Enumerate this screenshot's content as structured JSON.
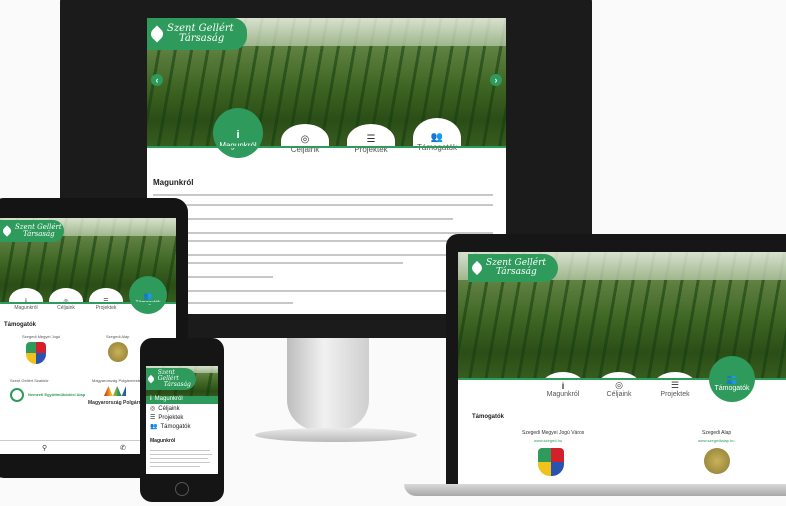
{
  "site": {
    "logo_line1": "Szent Gellért",
    "logo_line2": "Társaság"
  },
  "tabs": [
    {
      "label": "Magunkról",
      "icon": "info-icon"
    },
    {
      "label": "Céljaink",
      "icon": "target-icon"
    },
    {
      "label": "Projektek",
      "icon": "list-icon"
    },
    {
      "label": "Támogatók",
      "icon": "people-icon"
    }
  ],
  "desktop": {
    "active_tab": "Magunkról",
    "heading": "Magunkról"
  },
  "tablet": {
    "active_tab": "Támogatók",
    "heading": "Támogatók",
    "sponsor_label": "Magyarország Polgármesteri Iroda"
  },
  "phone": {
    "menu": [
      "Magunkról",
      "Céljaink",
      "Projektek",
      "Támogatók"
    ],
    "heading": "Magunkról"
  },
  "laptop": {
    "active_tab": "Támogatók",
    "heading": "Támogatók",
    "sponsor1": "Szegedi Megyei Jogú Város",
    "sponsor2": "Szegedi Alap"
  },
  "colors": {
    "brand_green": "#2e9a5b",
    "device_black": "#1b1b1b"
  }
}
